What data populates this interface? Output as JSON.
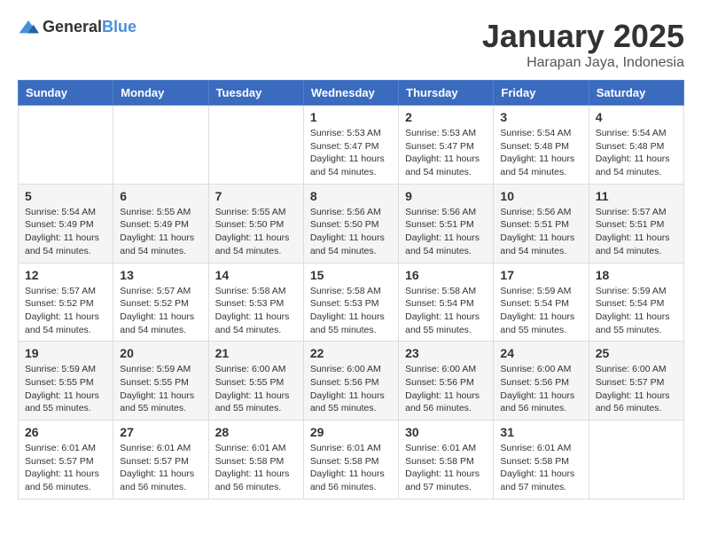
{
  "logo": {
    "general": "General",
    "blue": "Blue"
  },
  "title": "January 2025",
  "location": "Harapan Jaya, Indonesia",
  "headers": [
    "Sunday",
    "Monday",
    "Tuesday",
    "Wednesday",
    "Thursday",
    "Friday",
    "Saturday"
  ],
  "weeks": [
    [
      {
        "day": "",
        "info": ""
      },
      {
        "day": "",
        "info": ""
      },
      {
        "day": "",
        "info": ""
      },
      {
        "day": "1",
        "info": "Sunrise: 5:53 AM\nSunset: 5:47 PM\nDaylight: 11 hours\nand 54 minutes."
      },
      {
        "day": "2",
        "info": "Sunrise: 5:53 AM\nSunset: 5:47 PM\nDaylight: 11 hours\nand 54 minutes."
      },
      {
        "day": "3",
        "info": "Sunrise: 5:54 AM\nSunset: 5:48 PM\nDaylight: 11 hours\nand 54 minutes."
      },
      {
        "day": "4",
        "info": "Sunrise: 5:54 AM\nSunset: 5:48 PM\nDaylight: 11 hours\nand 54 minutes."
      }
    ],
    [
      {
        "day": "5",
        "info": "Sunrise: 5:54 AM\nSunset: 5:49 PM\nDaylight: 11 hours\nand 54 minutes."
      },
      {
        "day": "6",
        "info": "Sunrise: 5:55 AM\nSunset: 5:49 PM\nDaylight: 11 hours\nand 54 minutes."
      },
      {
        "day": "7",
        "info": "Sunrise: 5:55 AM\nSunset: 5:50 PM\nDaylight: 11 hours\nand 54 minutes."
      },
      {
        "day": "8",
        "info": "Sunrise: 5:56 AM\nSunset: 5:50 PM\nDaylight: 11 hours\nand 54 minutes."
      },
      {
        "day": "9",
        "info": "Sunrise: 5:56 AM\nSunset: 5:51 PM\nDaylight: 11 hours\nand 54 minutes."
      },
      {
        "day": "10",
        "info": "Sunrise: 5:56 AM\nSunset: 5:51 PM\nDaylight: 11 hours\nand 54 minutes."
      },
      {
        "day": "11",
        "info": "Sunrise: 5:57 AM\nSunset: 5:51 PM\nDaylight: 11 hours\nand 54 minutes."
      }
    ],
    [
      {
        "day": "12",
        "info": "Sunrise: 5:57 AM\nSunset: 5:52 PM\nDaylight: 11 hours\nand 54 minutes."
      },
      {
        "day": "13",
        "info": "Sunrise: 5:57 AM\nSunset: 5:52 PM\nDaylight: 11 hours\nand 54 minutes."
      },
      {
        "day": "14",
        "info": "Sunrise: 5:58 AM\nSunset: 5:53 PM\nDaylight: 11 hours\nand 54 minutes."
      },
      {
        "day": "15",
        "info": "Sunrise: 5:58 AM\nSunset: 5:53 PM\nDaylight: 11 hours\nand 55 minutes."
      },
      {
        "day": "16",
        "info": "Sunrise: 5:58 AM\nSunset: 5:54 PM\nDaylight: 11 hours\nand 55 minutes."
      },
      {
        "day": "17",
        "info": "Sunrise: 5:59 AM\nSunset: 5:54 PM\nDaylight: 11 hours\nand 55 minutes."
      },
      {
        "day": "18",
        "info": "Sunrise: 5:59 AM\nSunset: 5:54 PM\nDaylight: 11 hours\nand 55 minutes."
      }
    ],
    [
      {
        "day": "19",
        "info": "Sunrise: 5:59 AM\nSunset: 5:55 PM\nDaylight: 11 hours\nand 55 minutes."
      },
      {
        "day": "20",
        "info": "Sunrise: 5:59 AM\nSunset: 5:55 PM\nDaylight: 11 hours\nand 55 minutes."
      },
      {
        "day": "21",
        "info": "Sunrise: 6:00 AM\nSunset: 5:55 PM\nDaylight: 11 hours\nand 55 minutes."
      },
      {
        "day": "22",
        "info": "Sunrise: 6:00 AM\nSunset: 5:56 PM\nDaylight: 11 hours\nand 55 minutes."
      },
      {
        "day": "23",
        "info": "Sunrise: 6:00 AM\nSunset: 5:56 PM\nDaylight: 11 hours\nand 56 minutes."
      },
      {
        "day": "24",
        "info": "Sunrise: 6:00 AM\nSunset: 5:56 PM\nDaylight: 11 hours\nand 56 minutes."
      },
      {
        "day": "25",
        "info": "Sunrise: 6:00 AM\nSunset: 5:57 PM\nDaylight: 11 hours\nand 56 minutes."
      }
    ],
    [
      {
        "day": "26",
        "info": "Sunrise: 6:01 AM\nSunset: 5:57 PM\nDaylight: 11 hours\nand 56 minutes."
      },
      {
        "day": "27",
        "info": "Sunrise: 6:01 AM\nSunset: 5:57 PM\nDaylight: 11 hours\nand 56 minutes."
      },
      {
        "day": "28",
        "info": "Sunrise: 6:01 AM\nSunset: 5:58 PM\nDaylight: 11 hours\nand 56 minutes."
      },
      {
        "day": "29",
        "info": "Sunrise: 6:01 AM\nSunset: 5:58 PM\nDaylight: 11 hours\nand 56 minutes."
      },
      {
        "day": "30",
        "info": "Sunrise: 6:01 AM\nSunset: 5:58 PM\nDaylight: 11 hours\nand 57 minutes."
      },
      {
        "day": "31",
        "info": "Sunrise: 6:01 AM\nSunset: 5:58 PM\nDaylight: 11 hours\nand 57 minutes."
      },
      {
        "day": "",
        "info": ""
      }
    ]
  ]
}
